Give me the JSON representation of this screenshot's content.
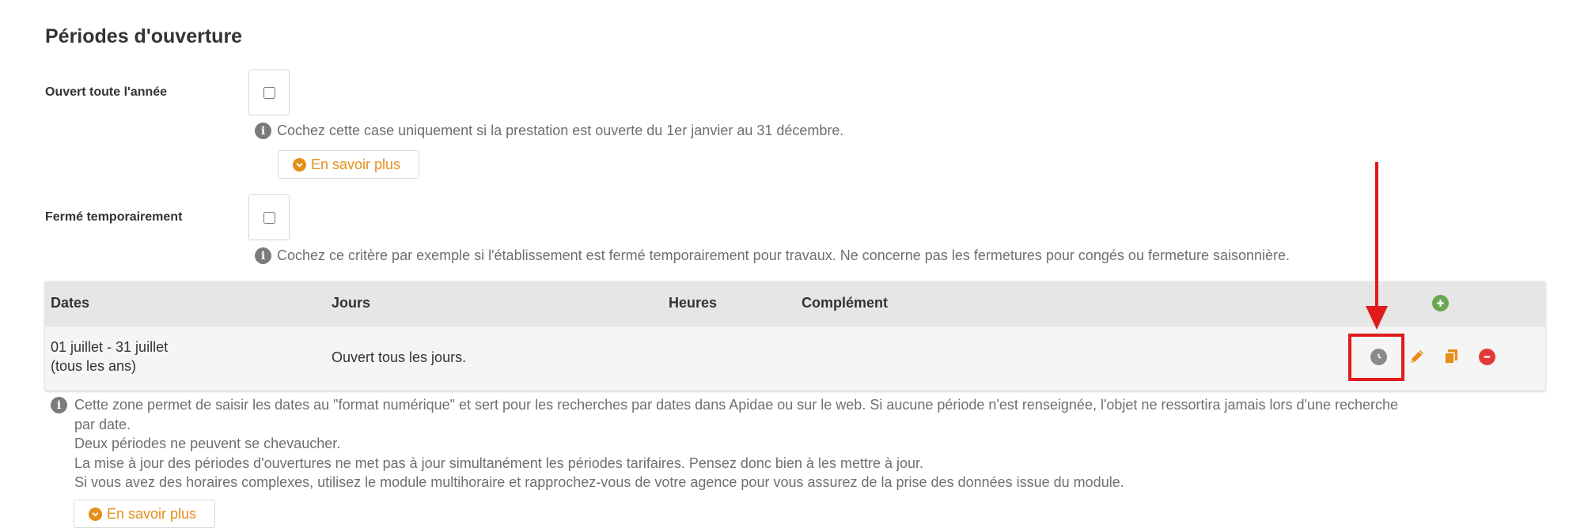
{
  "section": {
    "title": "Périodes d'ouverture"
  },
  "open_all_year": {
    "label": "Ouvert toute l'année",
    "checked": false,
    "help": "Cochez cette case uniquement si la prestation est ouverte du 1er janvier au 31 décembre.",
    "more_label": "En savoir plus"
  },
  "temporarily_closed": {
    "label": "Fermé temporairement",
    "checked": false,
    "help": "Cochez ce critère par exemple si l'établissement est fermé temporairement pour travaux. Ne concerne pas les fermetures pour congés ou fermeture saisonnière."
  },
  "periods_table": {
    "headers": {
      "dates": "Dates",
      "days": "Jours",
      "hours": "Heures",
      "complement": "Complément"
    },
    "add_icon": "plus-circle-icon",
    "rows": [
      {
        "dates_line1": "01 juillet - 31 juillet",
        "dates_line2": "(tous les ans)",
        "days": "Ouvert tous les jours.",
        "hours": "",
        "complement": "",
        "actions": [
          "clock-icon",
          "pencil-icon",
          "copy-icon",
          "minus-circle-icon"
        ]
      }
    ]
  },
  "periods_info": {
    "lines": [
      "Cette zone permet de saisir les dates au \"format numérique\" et sert pour les recherches par dates dans Apidae ou sur le web. Si aucune période n'est renseignée, l'objet ne ressortira jamais lors d'une recherche",
      "par date.",
      "Deux périodes ne peuvent se chevaucher.",
      "La mise à jour des périodes d'ouvertures ne met pas à jour simultanément les périodes tarifaires. Pensez donc bien à les mettre à jour.",
      "Si vous avez des horaires complexes, utilisez le module multihoraire et rapprochez-vous de votre agence pour vous assurez de la prise des données issue du module."
    ],
    "more_label": "En savoir plus"
  },
  "colors": {
    "accent_orange": "#e58e1a",
    "add_green": "#6aa84f",
    "delete_red": "#e03a3a",
    "highlight_red": "#e01b1b"
  }
}
